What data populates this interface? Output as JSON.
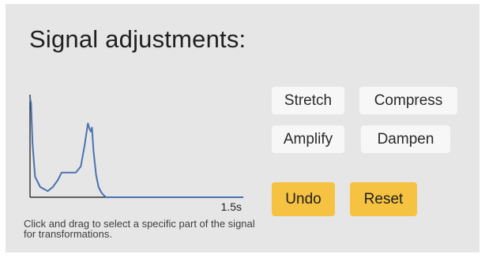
{
  "panel": {
    "title": "Signal adjustments:",
    "hint": "Click and drag to select a specific part of the signal for transformations."
  },
  "chart": {
    "end_label": "1.5s",
    "line_color": "#4a72b0",
    "points": [
      [
        0,
        0.97
      ],
      [
        0.02,
        0.92
      ],
      [
        0.05,
        0.52
      ],
      [
        0.1,
        0.2
      ],
      [
        0.2,
        0.1
      ],
      [
        0.35,
        0.06
      ],
      [
        0.45,
        0.1
      ],
      [
        0.55,
        0.17
      ],
      [
        0.62,
        0.24
      ],
      [
        0.72,
        0.24
      ],
      [
        0.82,
        0.24
      ],
      [
        0.9,
        0.24
      ],
      [
        1.0,
        0.3
      ],
      [
        1.08,
        0.52
      ],
      [
        1.14,
        0.72
      ],
      [
        1.17,
        0.67
      ],
      [
        1.2,
        0.64
      ],
      [
        1.22,
        0.68
      ],
      [
        1.25,
        0.45
      ],
      [
        1.3,
        0.22
      ],
      [
        1.35,
        0.1
      ],
      [
        1.4,
        0.05
      ],
      [
        1.45,
        0.02
      ],
      [
        1.5,
        0.0
      ],
      [
        1.7,
        0.0
      ],
      [
        2.5,
        0.0
      ],
      [
        3.5,
        0.0
      ],
      [
        4.2,
        0.0
      ]
    ]
  },
  "buttons": {
    "stretch": "Stretch",
    "compress": "Compress",
    "amplify": "Amplify",
    "dampen": "Dampen",
    "undo": "Undo",
    "reset": "Reset"
  },
  "colors": {
    "panel_bg": "#e6e6e6",
    "button_light": "#f7f7f7",
    "button_warn": "#f5c242"
  }
}
